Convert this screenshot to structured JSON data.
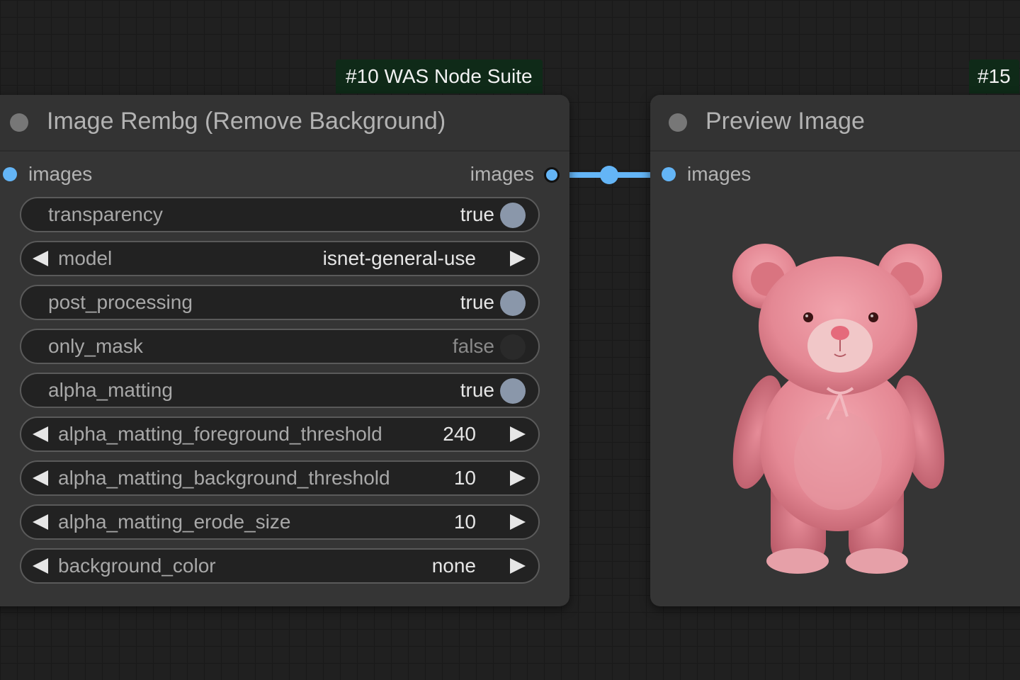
{
  "canvas": {
    "badges": [
      {
        "label": "#10 WAS Node Suite"
      },
      {
        "label": "#15"
      }
    ]
  },
  "rembg_node": {
    "title": "Image Rembg (Remove Background)",
    "input_label": "images",
    "output_label": "images",
    "widgets": [
      {
        "name": "transparency",
        "value": "true",
        "kind": "toggle",
        "on": true
      },
      {
        "name": "model",
        "value": "isnet-general-use",
        "kind": "combo"
      },
      {
        "name": "post_processing",
        "value": "true",
        "kind": "toggle",
        "on": true
      },
      {
        "name": "only_mask",
        "value": "false",
        "kind": "toggle",
        "on": false
      },
      {
        "name": "alpha_matting",
        "value": "true",
        "kind": "toggle",
        "on": true
      },
      {
        "name": "alpha_matting_foreground_threshold",
        "value": "240",
        "kind": "number"
      },
      {
        "name": "alpha_matting_background_threshold",
        "value": "10",
        "kind": "number"
      },
      {
        "name": "alpha_matting_erode_size",
        "value": "10",
        "kind": "number"
      },
      {
        "name": "background_color",
        "value": "none",
        "kind": "combo"
      }
    ]
  },
  "preview_node": {
    "title": "Preview Image",
    "input_label": "images",
    "image": "pink-teddy-bear-cutout"
  },
  "colors": {
    "link": "#64b5f6",
    "badge_bg": "#0f2a18",
    "node_bg": "#353535",
    "toggle_on": "#8a97aa"
  }
}
